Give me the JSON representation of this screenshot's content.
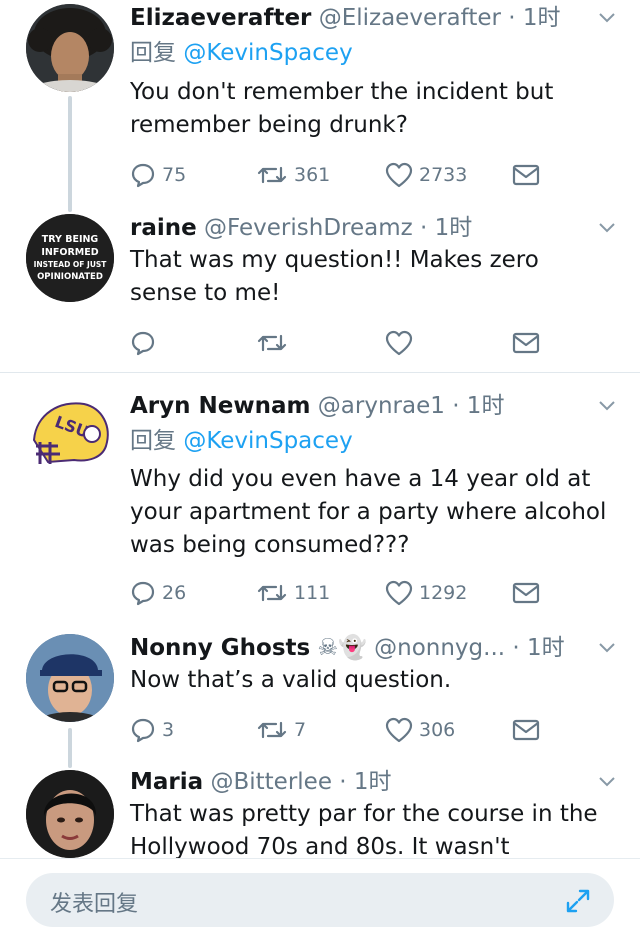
{
  "tweets": [
    {
      "name": "Elizaeverafter",
      "handle": "@Elizaeverafter",
      "time": "· 1时",
      "reply_label": "回复",
      "reply_to": "@KevinSpacey",
      "text": "You don't remember the incident but remember being drunk?",
      "replies": "75",
      "retweets": "361",
      "likes": "2733"
    },
    {
      "name": "raine",
      "handle": "@FeverishDreamz",
      "time": "· 1时",
      "avatar_text": [
        "TRY BEING",
        "INFORMED",
        "INSTEAD OF JUST",
        "OPINIONATED"
      ],
      "text": "That was my question!! Makes zero sense to me!",
      "replies": "",
      "retweets": "",
      "likes": ""
    },
    {
      "name": "Aryn Newnam",
      "handle": "@arynrae1",
      "time": "· 1时",
      "avatar_text": "LSU",
      "reply_label": "回复",
      "reply_to": "@KevinSpacey",
      "text": "Why did you even have a 14 year old at your apartment for a party where alcohol was being consumed???",
      "replies": "26",
      "retweets": "111",
      "likes": "1292"
    },
    {
      "name": "Nonny Ghosts",
      "emoji": "☠👻",
      "handle": "@nonnyg...",
      "time": "· 1时",
      "text": "Now that’s a valid question.",
      "replies": "3",
      "retweets": "7",
      "likes": "306"
    },
    {
      "name": "Maria",
      "handle": "@Bitterlee",
      "time": "· 1时",
      "text": "That was pretty par for the course in the Hollywood 70s and 80s. It wasn't"
    }
  ],
  "reply_bar": {
    "placeholder": "发表回复"
  },
  "colors": {
    "accent": "#1da1f2",
    "muted": "#657786",
    "thread": "#ccd6dd",
    "divider": "#e1e8ed"
  },
  "icons": [
    "reply-icon",
    "retweet-icon",
    "like-icon",
    "message-icon",
    "chevron-down-icon",
    "expand-icon"
  ]
}
